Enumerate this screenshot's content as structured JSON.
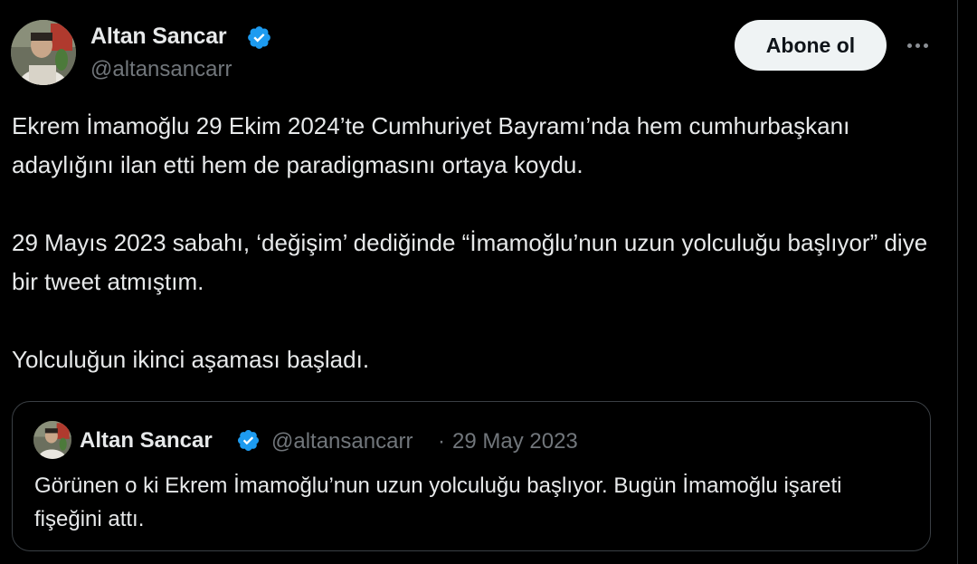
{
  "tweet": {
    "author": {
      "name": "Altan Sancar",
      "handle": "@altansancarr",
      "verified": true,
      "avatar_icon": "profile-photo"
    },
    "follow_label": "Abone ol",
    "more_icon": "more-horizontal-icon",
    "paragraphs": [
      "Ekrem İmamoğlu 29 Ekim 2024’te Cumhuriyet Bayramı’nda hem cumhurbaşkanı adaylığını ilan etti hem de paradigmasını ortaya koydu.",
      "29 Mayıs 2023 sabahı, ‘değişim’ dediğinde “İmamoğlu’nun uzun yolculuğu başlıyor” diye bir tweet atmıştım.",
      "Yolculuğun ikinci aşaması başladı."
    ]
  },
  "quote": {
    "author": {
      "name": "Altan Sancar",
      "handle": "@altansancarr",
      "verified": true
    },
    "separator": "·",
    "date": "29 May 2023",
    "text": "Görünen o ki Ekrem İmamoğlu’nun uzun yolculuğu başlıyor. Bugün İmamoğlu işareti fişeğini attı."
  },
  "colors": {
    "background": "#000000",
    "text_primary": "#e7e9ea",
    "text_secondary": "#71767b",
    "verified_blue": "#1d9bf0",
    "follow_button_bg": "#eff3f4",
    "border": "#3a3f44"
  }
}
